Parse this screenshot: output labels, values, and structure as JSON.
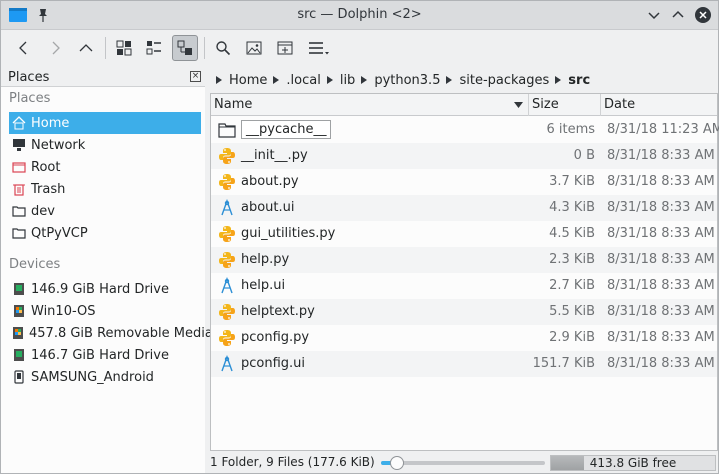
{
  "window": {
    "title": "src — Dolphin <2>"
  },
  "places": {
    "header": "Places",
    "section_places": "Places",
    "section_devices": "Devices",
    "items": [
      {
        "label": "Home",
        "icon": "home-icon"
      },
      {
        "label": "Network",
        "icon": "network-icon"
      },
      {
        "label": "Root",
        "icon": "root-folder-icon"
      },
      {
        "label": "Trash",
        "icon": "trash-icon"
      },
      {
        "label": "dev",
        "icon": "folder-icon"
      },
      {
        "label": "QtPyVCP",
        "icon": "folder-icon"
      }
    ],
    "devices": [
      {
        "label": "146.9 GiB Hard Drive",
        "icon": "hard-drive-icon"
      },
      {
        "label": "Win10-OS",
        "icon": "windows-drive-icon"
      },
      {
        "label": "457.8 GiB Removable Media",
        "icon": "removable-drive-icon"
      },
      {
        "label": "146.7 GiB Hard Drive",
        "icon": "hard-drive-icon"
      },
      {
        "label": "SAMSUNG_Android",
        "icon": "phone-icon"
      }
    ]
  },
  "breadcrumb": [
    "Home",
    ".local",
    "lib",
    "python3.5",
    "site-packages",
    "src"
  ],
  "columns": {
    "name": "Name",
    "size": "Size",
    "date": "Date"
  },
  "files": [
    {
      "name": "__pycache__",
      "size": "6 items",
      "date": "8/31/18 11:23 AM",
      "type": "folder"
    },
    {
      "name": "__init__.py",
      "size": "0 B",
      "date": "8/31/18 8:33 AM",
      "type": "python"
    },
    {
      "name": "about.py",
      "size": "3.7 KiB",
      "date": "8/31/18 8:33 AM",
      "type": "python"
    },
    {
      "name": "about.ui",
      "size": "4.3 KiB",
      "date": "8/31/18 8:33 AM",
      "type": "ui"
    },
    {
      "name": "gui_utilities.py",
      "size": "4.5 KiB",
      "date": "8/31/18 8:33 AM",
      "type": "python"
    },
    {
      "name": "help.py",
      "size": "2.3 KiB",
      "date": "8/31/18 8:33 AM",
      "type": "python"
    },
    {
      "name": "help.ui",
      "size": "2.7 KiB",
      "date": "8/31/18 8:33 AM",
      "type": "ui"
    },
    {
      "name": "helptext.py",
      "size": "5.5 KiB",
      "date": "8/31/18 8:33 AM",
      "type": "python"
    },
    {
      "name": "pconfig.py",
      "size": "2.9 KiB",
      "date": "8/31/18 8:33 AM",
      "type": "python"
    },
    {
      "name": "pconfig.ui",
      "size": "151.7 KiB",
      "date": "8/31/18 8:33 AM",
      "type": "ui"
    }
  ],
  "status": {
    "summary": "1 Folder, 9 Files (177.6 KiB)",
    "free_space": "413.8 GiB free",
    "zoom_fraction": 0.1,
    "disk_used_fraction": 0.2
  },
  "colors": {
    "accent": "#3daee9",
    "python_yellow": "#f3b61a",
    "ui_blue": "#2d8fd5"
  }
}
